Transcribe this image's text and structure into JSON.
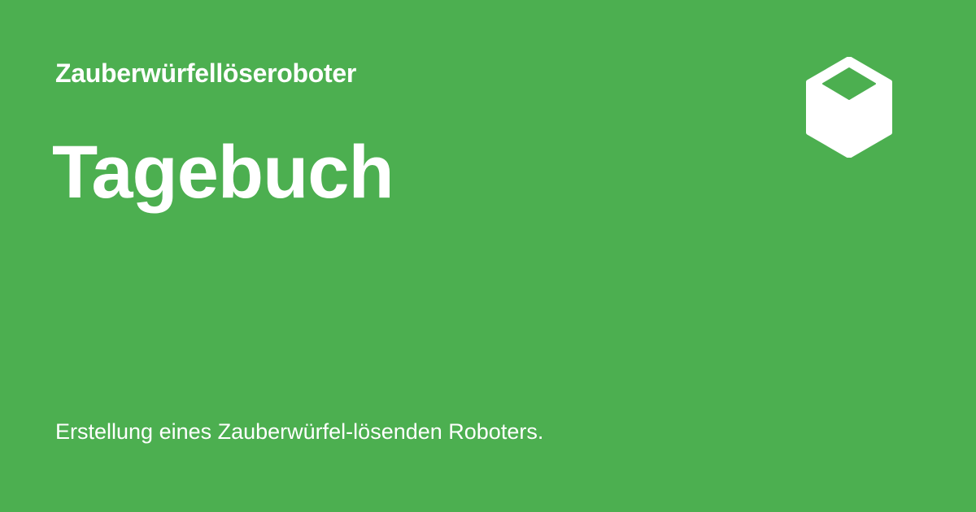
{
  "site": {
    "name": "Zauberwürfellöseroboter"
  },
  "page": {
    "title": "Tagebuch",
    "description": "Erstellung eines Zauberwürfel-lösenden Roboters."
  },
  "theme": {
    "background": "#4caf50",
    "foreground": "#ffffff"
  },
  "logo": {
    "icon": "cube-icon"
  }
}
